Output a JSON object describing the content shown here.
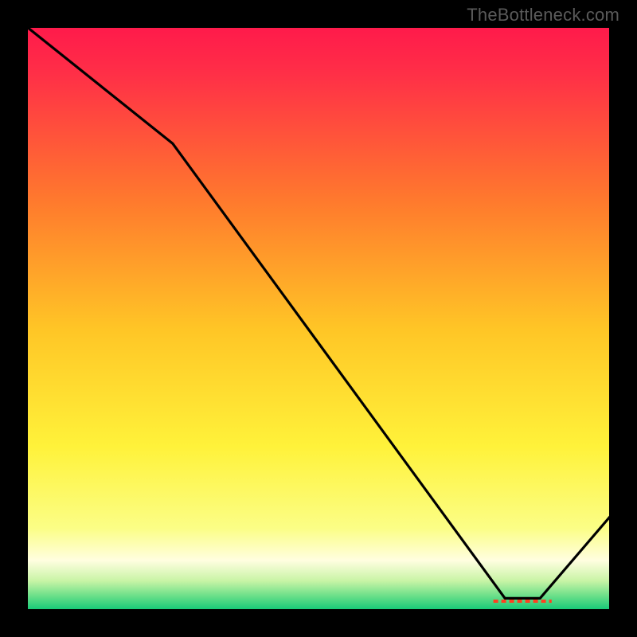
{
  "watermark": "TheBottleneck.com",
  "chart_data": {
    "type": "line",
    "title": "",
    "xlabel": "",
    "ylabel": "",
    "xlim": [
      0,
      100
    ],
    "ylim": [
      0,
      100
    ],
    "note": "Axes are unlabeled in the source image; values below are normalized estimates (0–100 on each axis) read from the shape of the curve.",
    "series": [
      {
        "name": "curve",
        "points": [
          {
            "x": 0,
            "y": 100
          },
          {
            "x": 25,
            "y": 80
          },
          {
            "x": 82,
            "y": 2
          },
          {
            "x": 88,
            "y": 2
          },
          {
            "x": 100,
            "y": 16
          }
        ]
      }
    ],
    "highlight_segment": {
      "note": "Short emphasized segment along the x-axis near the right side, rendered as a dashed red/orange line.",
      "x_start": 80,
      "x_end": 90,
      "y": 1.5
    },
    "background_gradient_stops": [
      {
        "offset": 0.0,
        "color": "#ff1a4b"
      },
      {
        "offset": 0.08,
        "color": "#ff2f47"
      },
      {
        "offset": 0.3,
        "color": "#ff7a2d"
      },
      {
        "offset": 0.52,
        "color": "#ffc626"
      },
      {
        "offset": 0.72,
        "color": "#fff23a"
      },
      {
        "offset": 0.86,
        "color": "#fbfe86"
      },
      {
        "offset": 0.915,
        "color": "#fffee0"
      },
      {
        "offset": 0.95,
        "color": "#c9f4a6"
      },
      {
        "offset": 0.975,
        "color": "#6ee08a"
      },
      {
        "offset": 1.0,
        "color": "#14c977"
      }
    ]
  }
}
